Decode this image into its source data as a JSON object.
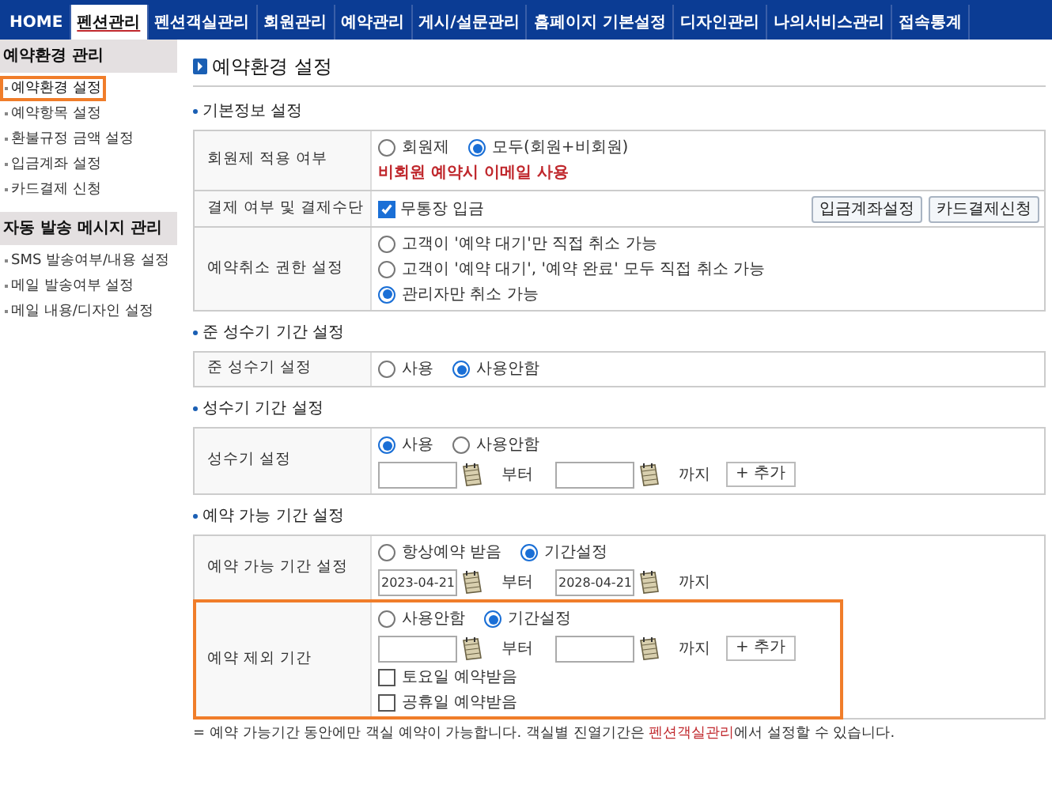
{
  "nav": [
    {
      "label": "HOME",
      "selected": false
    },
    {
      "label": "펜션관리",
      "selected": true
    },
    {
      "label": "펜션객실관리",
      "selected": false
    },
    {
      "label": "회원관리",
      "selected": false
    },
    {
      "label": "예약관리",
      "selected": false
    },
    {
      "label": "게시/설문관리",
      "selected": false
    },
    {
      "label": "홈페이지 기본설정",
      "selected": false
    },
    {
      "label": "디자인관리",
      "selected": false
    },
    {
      "label": "나의서비스관리",
      "selected": false
    },
    {
      "label": "접속통계",
      "selected": false
    }
  ],
  "sidebar": [
    {
      "title": "예약환경 관리",
      "items": [
        {
          "label": "예약환경 설정",
          "selected": true
        },
        {
          "label": "예약항목 설정",
          "selected": false
        },
        {
          "label": "환불규정 금액 설정",
          "selected": false
        },
        {
          "label": "입금계좌 설정",
          "selected": false
        },
        {
          "label": "카드결제 신청",
          "selected": false
        }
      ]
    },
    {
      "title": "자동 발송 메시지 관리",
      "items": [
        {
          "label": "SMS 발송여부/내용 설정",
          "selected": false
        },
        {
          "label": "메일 발송여부 설정",
          "selected": false
        },
        {
          "label": "메일 내용/디자인 설정",
          "selected": false
        }
      ]
    }
  ],
  "page_title": "예약환경 설정",
  "sections": [
    {
      "title": "기본정보 설정",
      "rows": [
        {
          "label": "회원제 적용 여부",
          "highlighted": false,
          "lines": [
            {
              "kind": "radios",
              "options": [
                {
                  "label": "회원제",
                  "selected": false
                },
                {
                  "label": "모두(회원+비회원)",
                  "selected": true
                }
              ]
            },
            {
              "kind": "note",
              "text": "비회원 예약시 이메일 사용"
            }
          ]
        },
        {
          "label": "결제 여부 및 결제수단",
          "highlighted": false,
          "lines": [
            {
              "kind": "checkbox_buttons",
              "label": "무통장 입금",
              "checked": true,
              "buttons": [
                "입금계좌설정",
                "카드결제신청"
              ]
            }
          ]
        },
        {
          "label": "예약취소 권한 설정",
          "highlighted": false,
          "lines": [
            {
              "kind": "radio_stack",
              "options": [
                {
                  "label": "고객이 '예약 대기'만 직접 취소 가능",
                  "selected": false
                },
                {
                  "label": "고객이 '예약 대기', '예약 완료' 모두 직접 취소 가능",
                  "selected": false
                },
                {
                  "label": "관리자만 취소 가능",
                  "selected": true
                }
              ]
            }
          ]
        }
      ]
    },
    {
      "title": "준 성수기 기간 설정",
      "rows": [
        {
          "label": "준 성수기 설정",
          "highlighted": false,
          "lines": [
            {
              "kind": "radios",
              "options": [
                {
                  "label": "사용",
                  "selected": false
                },
                {
                  "label": "사용안함",
                  "selected": true
                }
              ]
            }
          ]
        }
      ]
    },
    {
      "title": "성수기 기간 설정",
      "rows": [
        {
          "label": "성수기 설정",
          "highlighted": false,
          "lines": [
            {
              "kind": "radios",
              "options": [
                {
                  "label": "사용",
                  "selected": true
                },
                {
                  "label": "사용안함",
                  "selected": false
                }
              ]
            },
            {
              "kind": "dates",
              "from_label": "부터",
              "to_label": "까지",
              "add": "+ 추가"
            }
          ]
        }
      ]
    },
    {
      "title": "예약 가능 기간 설정",
      "rows": [
        {
          "label": "예약 가능 기간 설정",
          "highlighted": false,
          "lines": [
            {
              "kind": "radios",
              "options": [
                {
                  "label": "항상예약 받음",
                  "selected": false
                },
                {
                  "label": "기간설정",
                  "selected": true
                }
              ]
            },
            {
              "kind": "dates",
              "from": "2023-04-21",
              "from_label": "부터",
              "to": "2028-04-21",
              "to_label": "까지"
            }
          ]
        },
        {
          "label": "예약 제외 기간",
          "highlighted": true,
          "lines": [
            {
              "kind": "radios",
              "options": [
                {
                  "label": "사용안함",
                  "selected": false
                },
                {
                  "label": "기간설정",
                  "selected": true
                }
              ]
            },
            {
              "kind": "dates",
              "from_label": "부터",
              "to_label": "까지",
              "add": "+ 추가"
            },
            {
              "kind": "checkbox",
              "label": "토요일 예약받음",
              "checked": false
            },
            {
              "kind": "checkbox",
              "label": "공휴일 예약받음",
              "checked": false
            }
          ]
        }
      ]
    }
  ],
  "footnote": {
    "before": "= 예약 가능기간 동안에만 객실 예약이 가능합니다. 객실별 진열기간은 ",
    "link": "펜션객실관리",
    "after": "에서 설정할 수 있습니다."
  }
}
